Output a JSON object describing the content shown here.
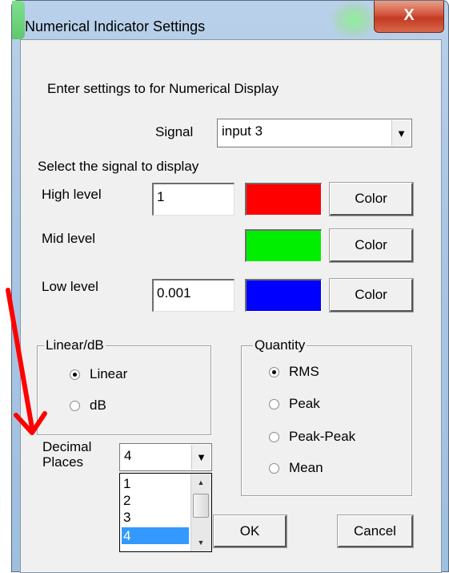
{
  "window": {
    "title": "Numerical Indicator Settings",
    "close_label": "X"
  },
  "prompt": "Enter settings to for Numerical Display",
  "signal": {
    "label": "Signal",
    "value": "input 3"
  },
  "select_prompt": "Select the signal to display",
  "levels": {
    "high": {
      "label": "High level",
      "value": "1",
      "color": "#ff0000",
      "button": "Color"
    },
    "mid": {
      "label": "Mid level",
      "color": "#00ee00",
      "button": "Color"
    },
    "low": {
      "label": "Low level",
      "value": "0.001",
      "color": "#0000ff",
      "button": "Color"
    }
  },
  "linear_db": {
    "legend": "Linear/dB",
    "options": [
      {
        "label": "Linear",
        "selected": true
      },
      {
        "label": "dB",
        "selected": false
      }
    ]
  },
  "quantity": {
    "legend": "Quantity",
    "options": [
      {
        "label": "RMS",
        "selected": true
      },
      {
        "label": "Peak",
        "selected": false
      },
      {
        "label": "Peak-Peak",
        "selected": false
      },
      {
        "label": "Mean",
        "selected": false
      }
    ]
  },
  "decimal": {
    "label_line1": "Decimal",
    "label_line2": "Places",
    "value": "4",
    "options": [
      "1",
      "2",
      "3",
      "4"
    ],
    "selected": "4"
  },
  "buttons": {
    "ok": "OK",
    "cancel": "Cancel"
  },
  "annotation_color": "#ff0000"
}
